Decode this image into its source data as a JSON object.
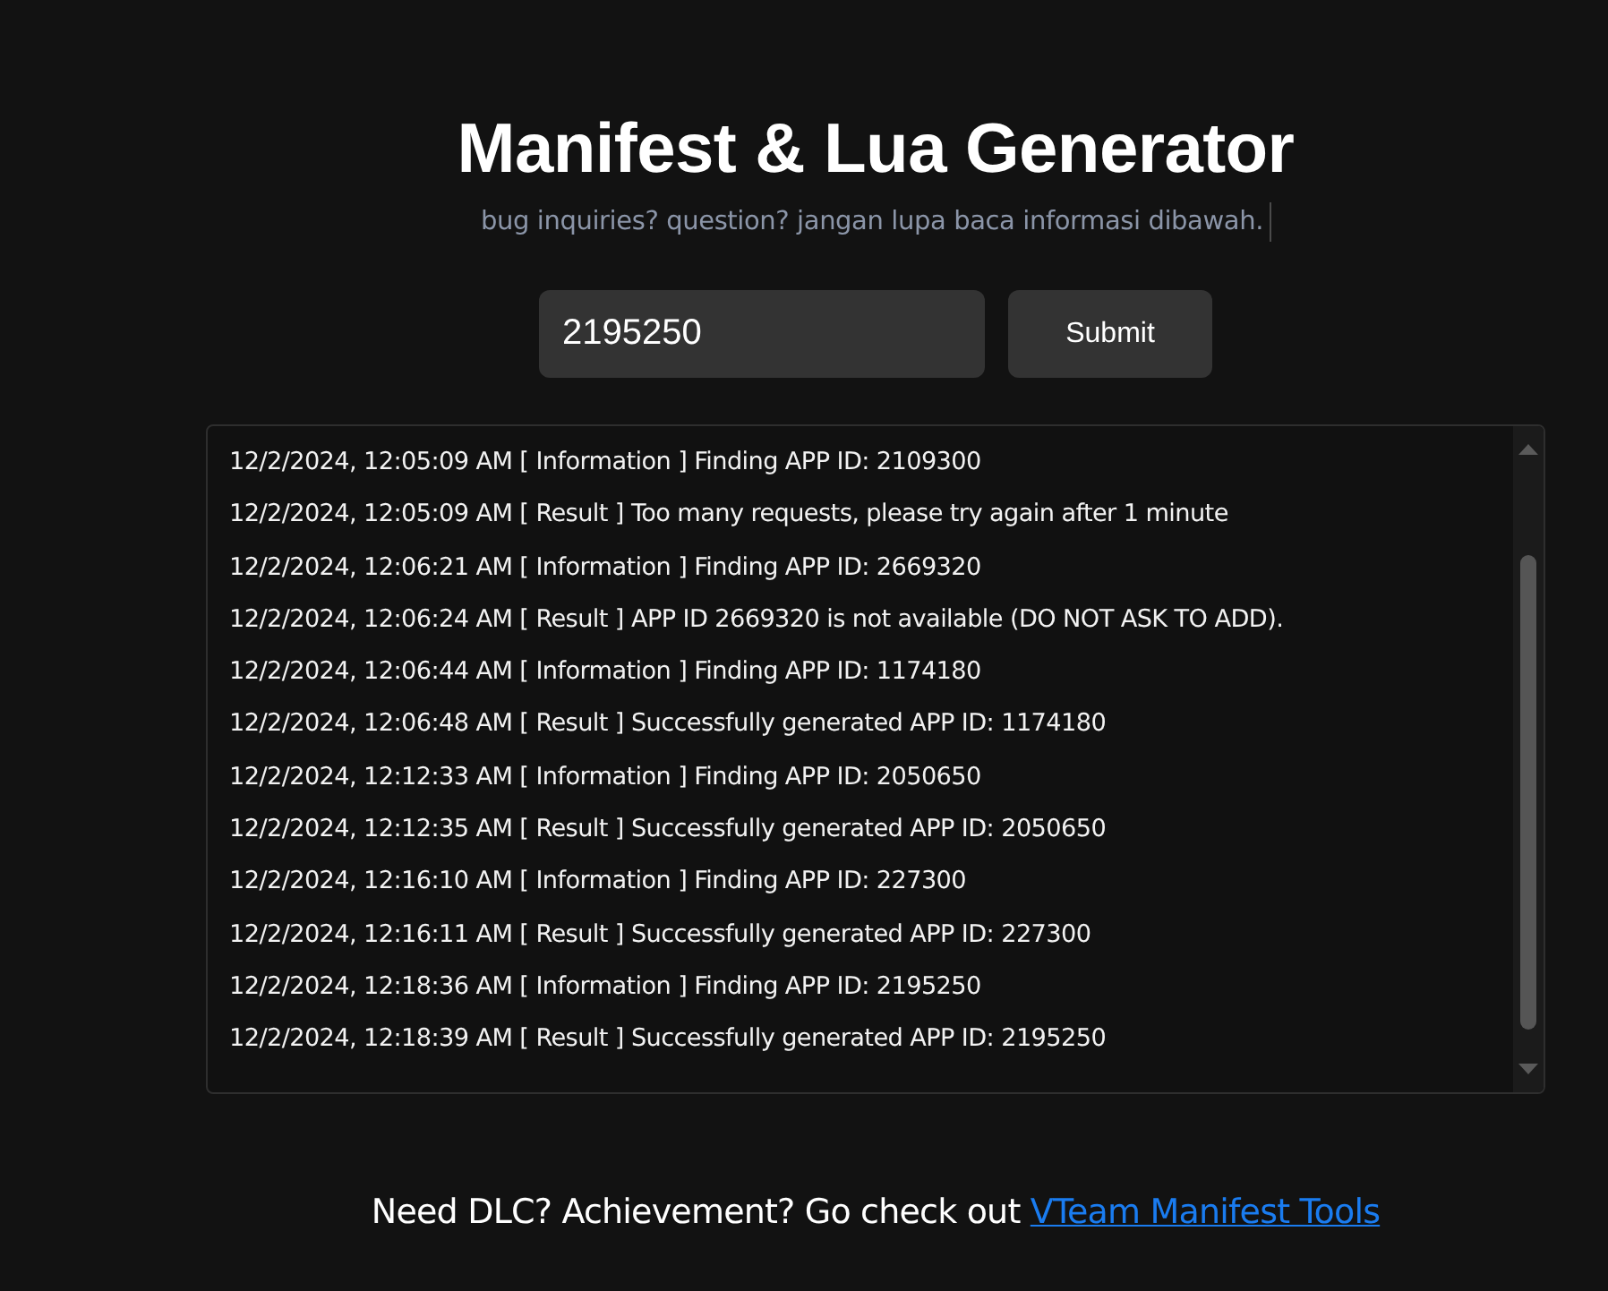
{
  "header": {
    "title": "Manifest & Lua Generator",
    "subtitle": "bug inquiries? question? jangan lupa baca informasi dibawah."
  },
  "form": {
    "app_id_value": "2195250",
    "submit_label": "Submit"
  },
  "log": {
    "lines": [
      "12/2/2024, 12:05:09 AM [ Information ] Finding APP ID: 2109300",
      "12/2/2024, 12:05:09 AM [ Result ] Too many requests, please try again after 1 minute",
      "12/2/2024, 12:06:21 AM [ Information ] Finding APP ID: 2669320",
      "12/2/2024, 12:06:24 AM [ Result ] APP ID 2669320 is not available (DO NOT ASK TO ADD).",
      "12/2/2024, 12:06:44 AM [ Information ] Finding APP ID: 1174180",
      "12/2/2024, 12:06:48 AM [ Result ] Successfully generated APP ID: 1174180",
      "12/2/2024, 12:12:33 AM [ Information ] Finding APP ID: 2050650",
      "12/2/2024, 12:12:35 AM [ Result ] Successfully generated APP ID: 2050650",
      "12/2/2024, 12:16:10 AM [ Information ] Finding APP ID: 227300",
      "12/2/2024, 12:16:11 AM [ Result ] Successfully generated APP ID: 227300",
      "12/2/2024, 12:18:36 AM [ Information ] Finding APP ID: 2195250",
      "12/2/2024, 12:18:39 AM [ Result ] Successfully generated APP ID: 2195250"
    ]
  },
  "footer": {
    "text": "Need DLC? Achievement? Go check out",
    "link": "VTeam Manifest Tools"
  }
}
